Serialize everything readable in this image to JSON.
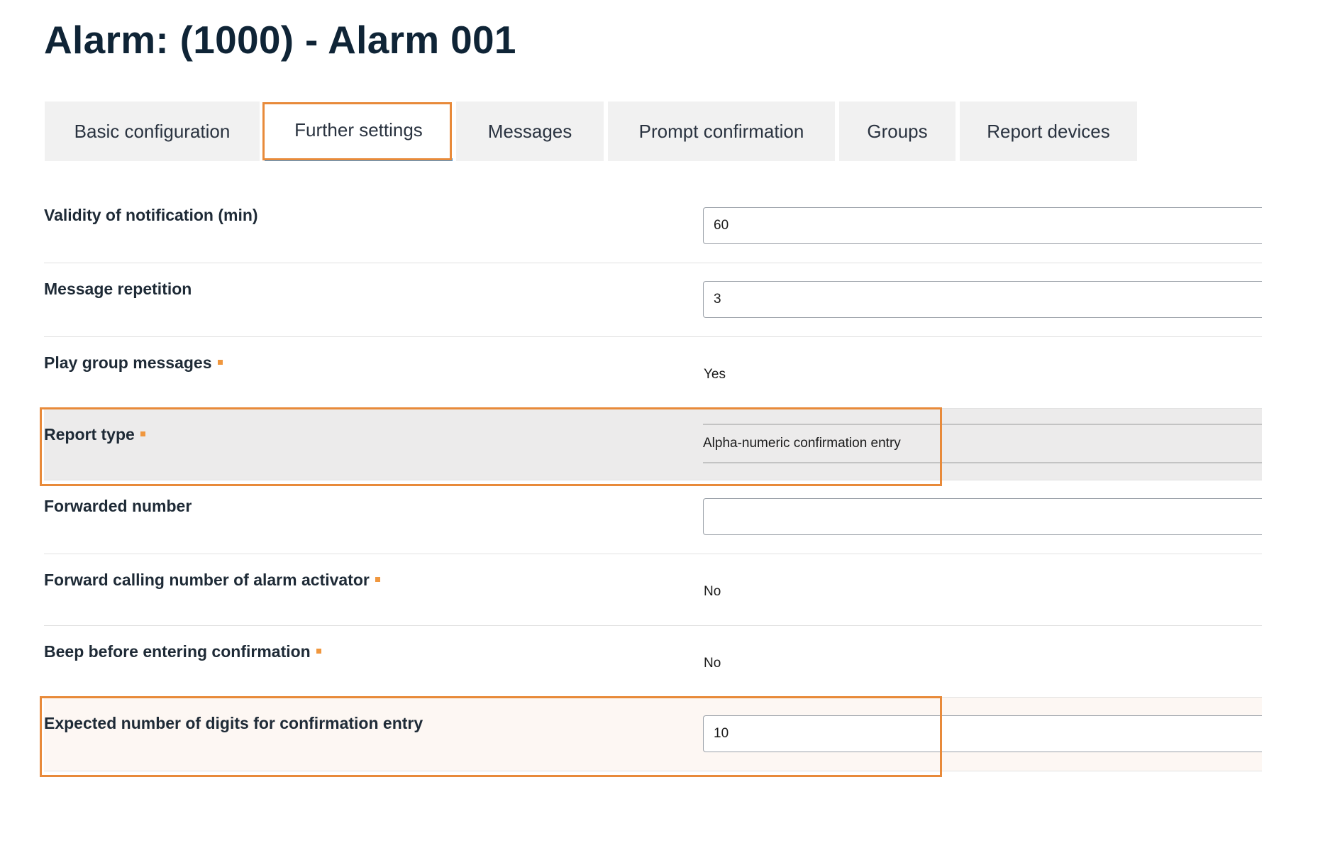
{
  "page": {
    "title": "Alarm: (1000) - Alarm 001"
  },
  "tabs": [
    {
      "label": "Basic configuration",
      "active": false
    },
    {
      "label": "Further settings",
      "active": true
    },
    {
      "label": "Messages",
      "active": false
    },
    {
      "label": "Prompt confirmation",
      "active": false
    },
    {
      "label": "Groups",
      "active": false
    },
    {
      "label": "Report devices",
      "active": false
    }
  ],
  "form": {
    "validity": {
      "label": "Validity of notification (min)",
      "value": "60"
    },
    "repetition": {
      "label": "Message repetition",
      "value": "3"
    },
    "play_group": {
      "label": "Play group messages",
      "value": "Yes"
    },
    "report_type": {
      "label": "Report type",
      "value": "Alpha-numeric confirmation entry"
    },
    "forwarded_number": {
      "label": "Forwarded number",
      "value": ""
    },
    "forward_calling": {
      "label": "Forward calling number of alarm activator",
      "value": "No"
    },
    "beep": {
      "label": "Beep before entering confirmation",
      "value": "No"
    },
    "expected_digits": {
      "label": "Expected number of digits for confirmation entry",
      "value": "10"
    }
  },
  "colors": {
    "highlight": "#e88a3a",
    "required_marker": "#f0973e",
    "active_tab_underline": "#4a97d8",
    "title": "#0f2436"
  }
}
